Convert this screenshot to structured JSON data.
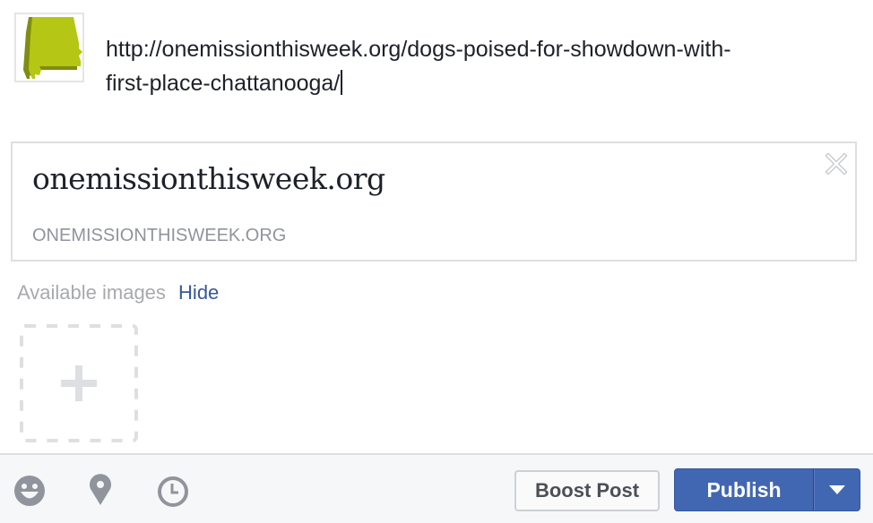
{
  "composer": {
    "avatar_icon": "alabama-state-shape-icon",
    "text_line1": "http://onemissionthisweek.org/dogs-poised-for-showdown-with-",
    "text_line2": "first-place-chattanooga/"
  },
  "link_preview": {
    "title": "onemissionthisweek.org",
    "domain": "ONEMISSIONTHISWEEK.ORG",
    "close_icon": "close-icon"
  },
  "images": {
    "label": "Available images",
    "hide_label": "Hide",
    "add_icon": "plus-icon"
  },
  "footer": {
    "icons": [
      "emoji-icon",
      "location-pin-icon",
      "clock-icon"
    ],
    "boost_label": "Boost Post",
    "publish_label": "Publish",
    "dropdown_icon": "caret-down-icon"
  },
  "colors": {
    "accent": "#4267b2",
    "link": "#365899",
    "avatar_green": "#b5c714"
  }
}
